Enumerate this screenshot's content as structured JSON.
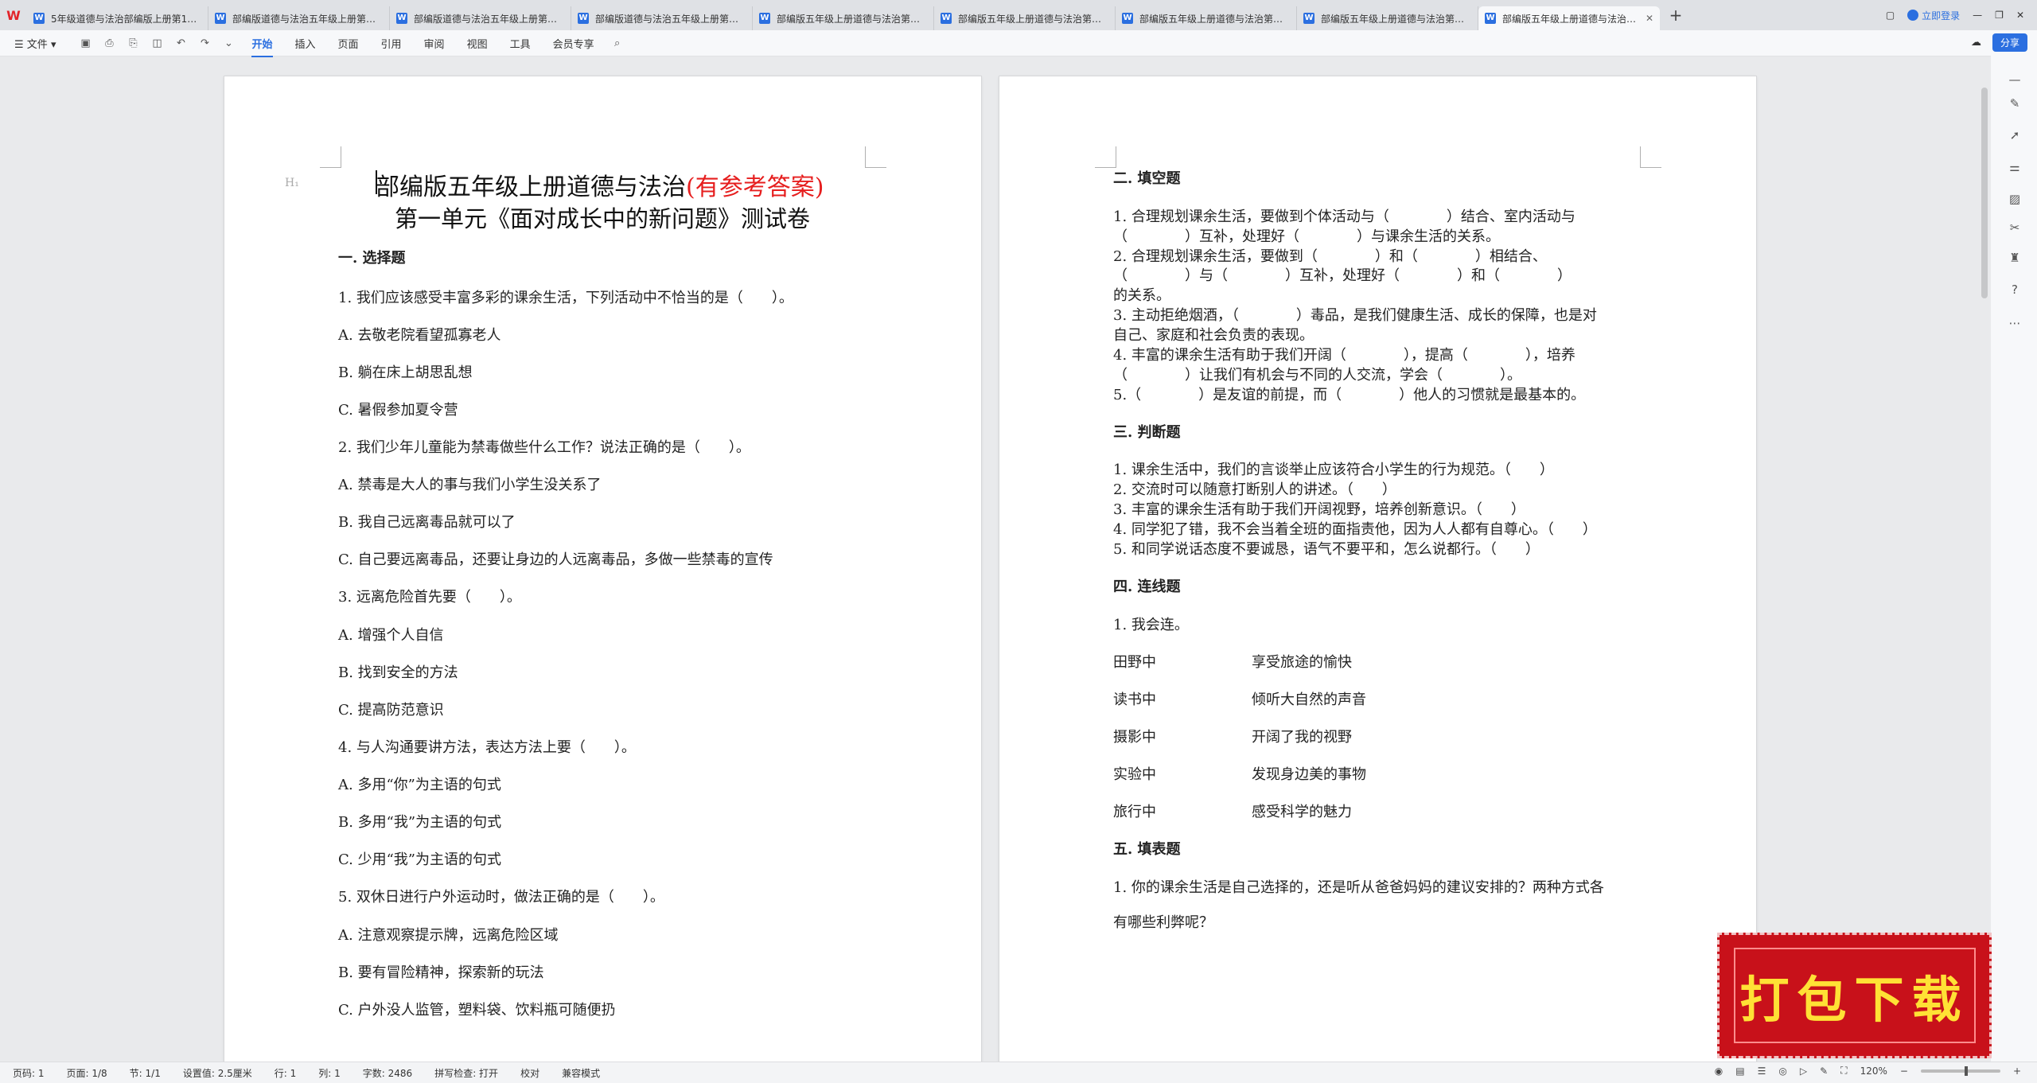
{
  "tabs": [
    {
      "label": "5年级道德与法治部编版上册第1单元"
    },
    {
      "label": "部编版道德与法治五年级上册第一单元"
    },
    {
      "label": "部编版道德与法治五年级上册第一单元"
    },
    {
      "label": "部编版道德与法治五年级上册第一单元"
    },
    {
      "label": "部编版五年级上册道德与法治第一单元"
    },
    {
      "label": "部编版五年级上册道德与法治第一单元"
    },
    {
      "label": "部编版五年级上册道德与法治第一单元"
    },
    {
      "label": "部编版五年级上册道德与法治第一单元"
    },
    {
      "label": "部编版五年级上册道德与法治第一单元"
    }
  ],
  "login_label": "立即登录",
  "toolbar": {
    "file_label": "文件",
    "menus": [
      "开始",
      "插入",
      "页面",
      "引用",
      "审阅",
      "视图",
      "工具",
      "会员专享"
    ],
    "share_label": "分享"
  },
  "page1": {
    "heading_mark": "H₁",
    "title_main": "部编版五年级上册道德与法治",
    "title_answer": "(有参考答案)",
    "subtitle": "第一单元《面对成长中的新问题》测试卷",
    "lines": [
      "一. 选择题",
      "1. 我们应该感受丰富多彩的课余生活，下列活动中不恰当的是（　　）。",
      "A. 去敬老院看望孤寡老人",
      "B. 躺在床上胡思乱想",
      "C. 暑假参加夏令营",
      "2. 我们少年儿童能为禁毒做些什么工作？说法正确的是（　　）。",
      "A. 禁毒是大人的事与我们小学生没关系了",
      "B. 我自己远离毒品就可以了",
      "C. 自己要远离毒品，还要让身边的人远离毒品，多做一些禁毒的宣传",
      "3. 远离危险首先要（　　）。",
      "A. 增强个人自信",
      "B. 找到安全的方法",
      "C. 提高防范意识",
      "4. 与人沟通要讲方法，表达方法上要（　　）。",
      "A. 多用“你”为主语的句式",
      "B. 多用“我”为主语的句式",
      "C. 少用“我”为主语的句式",
      "5. 双休日进行户外运动时，做法正确的是（　　）。",
      "A. 注意观察提示牌，远离危险区域",
      "B. 要有冒险精神，探索新的玩法",
      "C. 户外没人监管，塑料袋、饮料瓶可随便扔"
    ]
  },
  "page2": {
    "fill_title": "二. 填空题",
    "fill_lines": [
      "1. 合理规划课余生活，要做到个体活动与（　　　　）结合、室内活动与",
      "（　　　　）互补，处理好（　　　　）与课余生活的关系。",
      "2. 合理规划课余生活，要做到（　　　　）和（　　　　）相结合、",
      "（　　　　）与（　　　　）互补，处理好（　　　　）和（　　　　）",
      "的关系。",
      "3. 主动拒绝烟酒，（　　　　）毒品，是我们健康生活、成长的保障，也是对",
      "自己、家庭和社会负责的表现。",
      "4. 丰富的课余生活有助于我们开阔（　　　　），提高（　　　　），培养",
      "（　　　　）让我们有机会与不同的人交流，学会（　　　　）。",
      "5.（　　　　）是友谊的前提，而（　　　　）他人的习惯就是最基本的。"
    ],
    "judge_title": "三. 判断题",
    "judge_lines": [
      "1. 课余生活中，我们的言谈举止应该符合小学生的行为规范。（　　）",
      "2. 交流时可以随意打断别人的讲述。（　　）",
      "3. 丰富的课余生活有助于我们开阔视野，培养创新意识。（　　）",
      "4. 同学犯了错，我不会当着全班的面指责他，因为人人都有自尊心。（　　）",
      "5. 和同学说话态度不要诚恳，语气不要平和，怎么说都行。（　　）"
    ],
    "match_title": "四. 连线题",
    "match_intro": "1. 我会连。",
    "match_rows": [
      {
        "left": "田野中",
        "right": "享受旅途的愉快"
      },
      {
        "left": "读书中",
        "right": "倾听大自然的声音"
      },
      {
        "left": "摄影中",
        "right": "开阔了我的视野"
      },
      {
        "left": "实验中",
        "right": "发现身边美的事物"
      },
      {
        "left": "旅行中",
        "right": "感受科学的魅力"
      }
    ],
    "table_title": "五. 填表题",
    "table_lines": [
      "1. 你的课余生活是自己选择的，还是听从爸爸妈妈的建议安排的？两种方式各",
      "有哪些利弊呢？"
    ]
  },
  "status": {
    "page_num": "页码: 1",
    "pages": "页面: 1/8",
    "section": "节: 1/1",
    "setting": "设置值: 2.5厘米",
    "row": "行: 1",
    "col": "列: 1",
    "words": "字数: 2486",
    "spell": "拼写检查: 打开",
    "proof": "校对",
    "compat": "兼容模式",
    "zoom": "120%"
  },
  "download_label": "打包下载",
  "colors": {
    "accent": "#2b6fe0",
    "answer_red": "#e61e1e",
    "banner_red": "#c8111a",
    "banner_text": "#ffe135"
  }
}
